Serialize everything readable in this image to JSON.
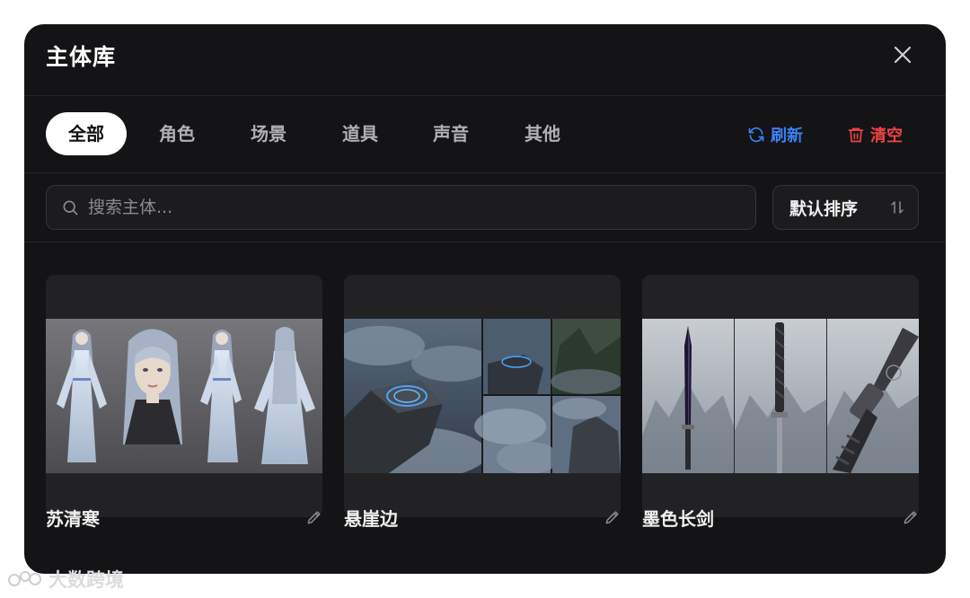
{
  "dialog": {
    "title": "主体库"
  },
  "tabs": [
    {
      "label": "全部",
      "active": true
    },
    {
      "label": "角色",
      "active": false
    },
    {
      "label": "场景",
      "active": false
    },
    {
      "label": "道具",
      "active": false
    },
    {
      "label": "声音",
      "active": false
    },
    {
      "label": "其他",
      "active": false
    }
  ],
  "actions": {
    "refresh_label": "刷新",
    "clear_label": "清空"
  },
  "search": {
    "placeholder": "搜索主体..."
  },
  "sort": {
    "label": "默认排序"
  },
  "cards": [
    {
      "name": "苏清寒"
    },
    {
      "name": "悬崖边"
    },
    {
      "name": "墨色长剑"
    }
  ],
  "watermark": {
    "text": "大数跨境"
  },
  "colors": {
    "refresh": "#3b82f6",
    "clear": "#ef4444",
    "background": "#141416",
    "card": "#222225"
  },
  "icons": {
    "close": "close-icon",
    "refresh": "refresh-icon",
    "clear": "trash-icon",
    "search": "search-icon",
    "sort": "sort-arrows-icon",
    "edit": "pencil-icon"
  }
}
